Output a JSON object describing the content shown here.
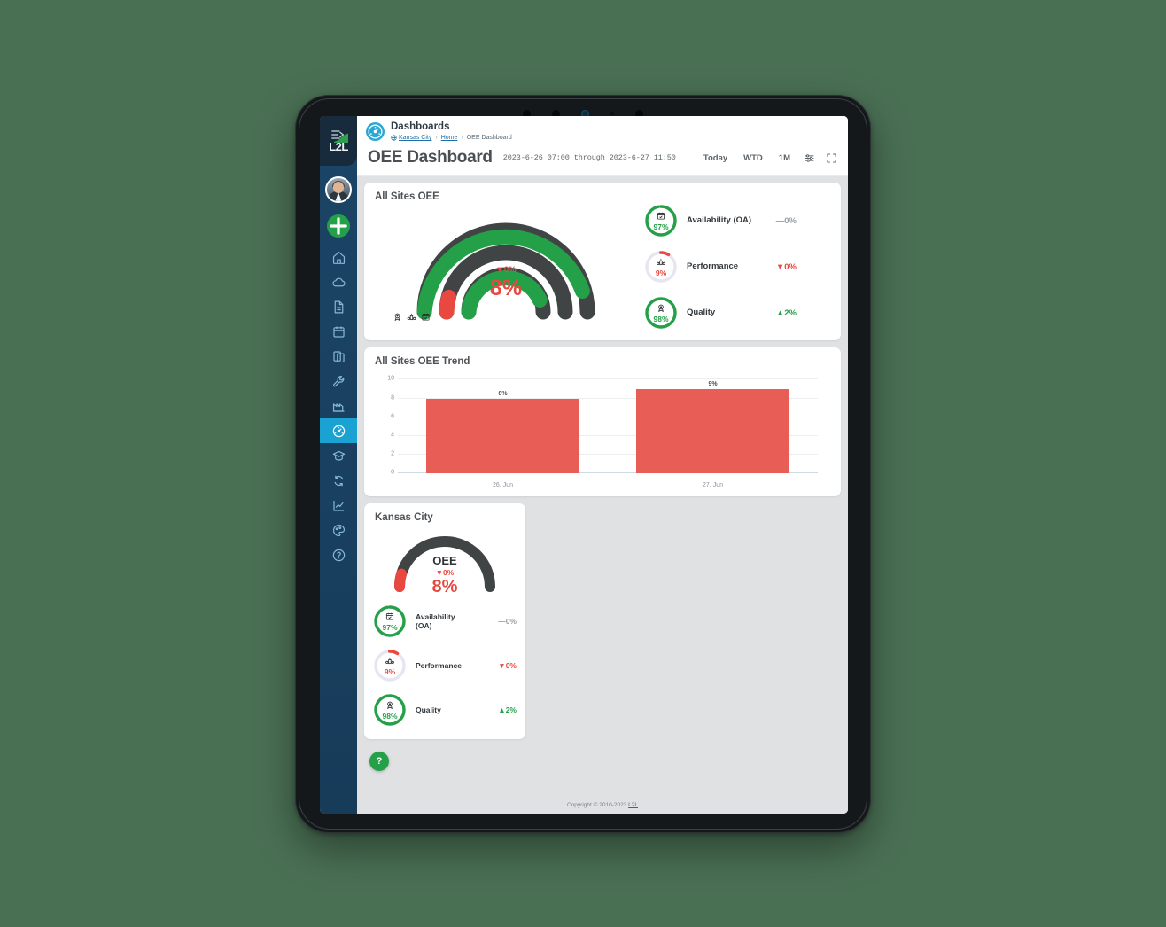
{
  "theme": {
    "page_bg": "#4a7054",
    "green": "#24a148",
    "red": "#e8483f",
    "bar_red": "#e95d57",
    "dark_arc": "#414445",
    "accent_blue": "#1aa3d2",
    "sidebar_bg": "#194263"
  },
  "sidebar": {
    "logo_text": "L2L",
    "collapse_icon": "collapse-arrow-icon",
    "logo_chart_icon": "green-growth-chart-icon",
    "avatar_name": "user-avatar",
    "add_label": "+",
    "items": [
      {
        "icon": "home-icon",
        "name": "home",
        "active": false
      },
      {
        "icon": "cloud-icon",
        "name": "cloud",
        "active": false
      },
      {
        "icon": "document-icon",
        "name": "documents",
        "active": false
      },
      {
        "icon": "calendar-icon",
        "name": "calendar",
        "active": false
      },
      {
        "icon": "clipboard-icon",
        "name": "clipboard",
        "active": false
      },
      {
        "icon": "wrench-icon",
        "name": "maintenance",
        "active": false
      },
      {
        "icon": "factory-icon",
        "name": "production",
        "active": false
      },
      {
        "icon": "gauge-icon",
        "name": "dashboards",
        "active": true
      },
      {
        "icon": "graduation-cap-icon",
        "name": "training",
        "active": false
      },
      {
        "icon": "refresh-cycle-icon",
        "name": "continuous-improvement",
        "active": false
      },
      {
        "icon": "line-chart-icon",
        "name": "reports",
        "active": false
      },
      {
        "icon": "palette-icon",
        "name": "theme",
        "active": false
      },
      {
        "icon": "help-circle-icon",
        "name": "help",
        "active": false
      }
    ]
  },
  "header": {
    "page_icon": "gauge-icon",
    "app_title": "Dashboards",
    "breadcrumb": {
      "site": "Kansas City",
      "site_icon": "globe-icon",
      "home": "Home",
      "current": "OEE Dashboard",
      "separator": "›"
    }
  },
  "titlebar": {
    "title": "OEE Dashboard",
    "date_range": "2023-6-26 07:00 through 2023-6-27 11:50",
    "range_buttons": [
      "Today",
      "WTD",
      "1M"
    ],
    "settings_icon": "sliders-icon",
    "fullscreen_icon": "expand-icon"
  },
  "all_sites_oee": {
    "card_title": "All Sites OEE",
    "gauge": {
      "delta": "▼0%",
      "value": "8%",
      "arcs": [
        {
          "name": "quality",
          "percent": 98,
          "color": "#24a148",
          "track": "#414445"
        },
        {
          "name": "performance",
          "percent": 9,
          "color": "#e8483f",
          "track": "#414445"
        },
        {
          "name": "availability",
          "percent": 97,
          "color": "#24a148",
          "track": "#414445"
        }
      ],
      "mini_icons": [
        "quality-badge-icon",
        "performance-bars-icon",
        "availability-calendar-icon"
      ]
    },
    "kpis": [
      {
        "icon": "availability-calendar-icon",
        "value": "97%",
        "label": "Availability (OA)",
        "delta": "—0%",
        "delta_dir": "flat",
        "ring_color": "#24a148",
        "ring_track": "#e3e6ef",
        "percent": 97
      },
      {
        "icon": "performance-bars-icon",
        "value": "9%",
        "label": "Performance",
        "delta": "▼0%",
        "delta_dir": "down",
        "ring_color": "#e8483f",
        "ring_track": "#e6e6f2",
        "percent": 9
      },
      {
        "icon": "quality-badge-icon",
        "value": "98%",
        "label": "Quality",
        "delta": "▲2%",
        "delta_dir": "up",
        "ring_color": "#24a148",
        "ring_track": "#e3e6ef",
        "percent": 98
      }
    ]
  },
  "trend_card": {
    "card_title": "All Sites OEE Trend"
  },
  "chart_data": {
    "type": "bar",
    "title": "All Sites OEE Trend",
    "categories": [
      "26. Jun",
      "27. Jun"
    ],
    "values": [
      8,
      9
    ],
    "data_labels": [
      "8%",
      "9%"
    ],
    "xlabel": "",
    "ylabel": "",
    "ylim": [
      0,
      10
    ],
    "yticks": [
      0,
      2,
      4,
      6,
      8,
      10
    ],
    "ytick_labels": [
      "0",
      "2",
      "4",
      "6",
      "8",
      "10"
    ],
    "grid": true,
    "legend": false,
    "bar_color": "#e95d57"
  },
  "site_card": {
    "card_title": "Kansas City",
    "gauge": {
      "label": "OEE",
      "delta": "▼0%",
      "value": "8%",
      "percent": 9,
      "color": "#e8483f",
      "track": "#414445"
    },
    "kpis": [
      {
        "icon": "availability-calendar-icon",
        "value": "97%",
        "label": "Availability (OA)",
        "delta": "—0%",
        "delta_dir": "flat",
        "ring_color": "#24a148",
        "ring_track": "#e3e6ef",
        "percent": 97
      },
      {
        "icon": "performance-bars-icon",
        "value": "9%",
        "label": "Performance",
        "delta": "▼0%",
        "delta_dir": "down",
        "ring_color": "#e8483f",
        "ring_track": "#e6e6f2",
        "percent": 9
      },
      {
        "icon": "quality-badge-icon",
        "value": "98%",
        "label": "Quality",
        "delta": "▲2%",
        "delta_dir": "up",
        "ring_color": "#24a148",
        "ring_track": "#e3e6ef",
        "percent": 98
      }
    ]
  },
  "help_fab": {
    "label": "?"
  },
  "footer": {
    "copyright": "Copyright © 2010-2023 ",
    "link": "L2L"
  }
}
